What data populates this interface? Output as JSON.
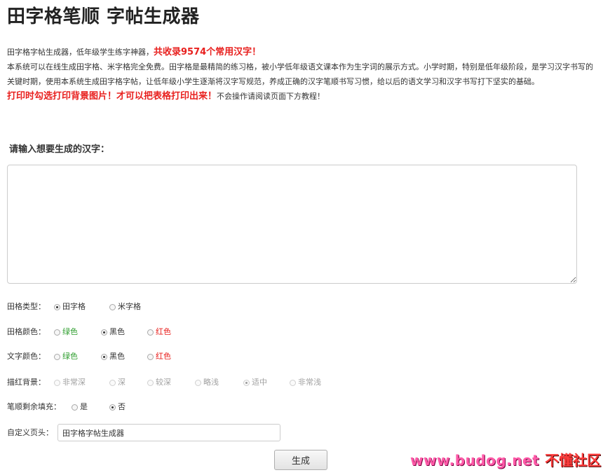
{
  "page": {
    "title": "田字格笔顺 字帖生成器"
  },
  "intro": {
    "line1_prefix": "田字格字帖生成器，低年级学生练字神器，",
    "line1_highlight": "共收录9574个常用汉字！",
    "paragraph": "本系统可以在线生成田字格、米字格完全免费。田字格是最精简的练习格，被小学低年级语文课本作为生字词的展示方式。小学时期，特别是低年级阶段，是学习汉字书写的关键时期，使用本系统生成田字格字帖，让低年级小学生逐渐将汉字写规范，养成正确的汉字笔顺书写习惯，给以后的语文学习和汉字书写打下坚实的基础。",
    "print_tip_highlight": "打印时勾选打印背景图片！才可以把表格打印出来！",
    "print_tip_suffix": "不会操作请阅读页面下方教程！"
  },
  "input": {
    "label": "请输入想要生成的汉字：",
    "value": ""
  },
  "options": {
    "grid_type": {
      "label": "田格类型：",
      "choices": [
        "田字格",
        "米字格"
      ],
      "selected": "田字格"
    },
    "grid_color": {
      "label": "田格颜色：",
      "choices": [
        "绿色",
        "黑色",
        "红色"
      ],
      "selected": "黑色"
    },
    "text_color": {
      "label": "文字颜色：",
      "choices": [
        "绿色",
        "黑色",
        "红色"
      ],
      "selected": "黑色"
    },
    "trace_background": {
      "label": "描红背景：",
      "choices": [
        "非常深",
        "深",
        "较深",
        "略浅",
        "适中",
        "非常浅"
      ],
      "selected": "适中",
      "enabled": false
    },
    "fill_remaining": {
      "label": "笔顺剩余填充：",
      "choices": [
        "是",
        "否"
      ],
      "selected": "否"
    },
    "custom_header": {
      "label": "自定义页头：",
      "value": "田字格字帖生成器"
    }
  },
  "actions": {
    "generate_label": "生成"
  },
  "watermark": {
    "url": "www.budog.net",
    "name": "不懂社区"
  },
  "colors": {
    "accent_red": "#e8201e",
    "green": "#2e9e2e",
    "muted": "#a0a0a0"
  }
}
